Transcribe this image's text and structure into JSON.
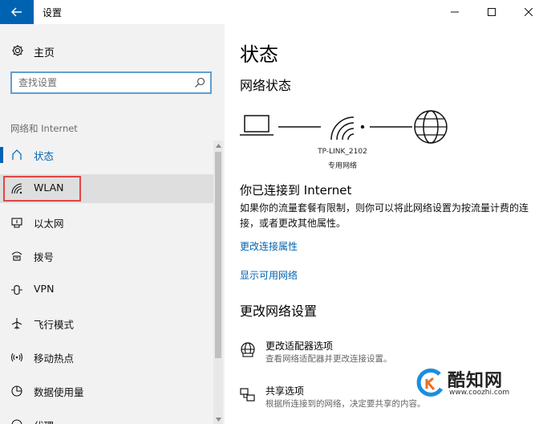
{
  "window": {
    "title": "设置",
    "controls": {
      "minimize": "—",
      "maximize": "☐",
      "close": "✕"
    }
  },
  "sidebar": {
    "home_label": "主页",
    "search": {
      "placeholder": "查找设置",
      "value": ""
    },
    "section_label": "网络和 Internet",
    "items": [
      {
        "label": "状态",
        "icon": "home-status-icon",
        "active": true
      },
      {
        "label": "WLAN",
        "icon": "wifi-icon",
        "highlighted": true
      },
      {
        "label": "以太网",
        "icon": "ethernet-icon"
      },
      {
        "label": "拨号",
        "icon": "dialup-icon"
      },
      {
        "label": "VPN",
        "icon": "vpn-icon"
      },
      {
        "label": "飞行模式",
        "icon": "airplane-icon"
      },
      {
        "label": "移动热点",
        "icon": "hotspot-icon"
      },
      {
        "label": "数据使用量",
        "icon": "data-usage-icon"
      },
      {
        "label": "代理",
        "icon": "proxy-icon"
      }
    ]
  },
  "main": {
    "page_title": "状态",
    "network_status_title": "网络状态",
    "network": {
      "name": "TP-LINK_2102",
      "type": "专用网络"
    },
    "connected_title": "你已连接到 Internet",
    "connected_desc": "如果你的流量套餐有限制，则你可以将此网络设置为按流量计费的连接，或者更改其他属性。",
    "links": {
      "change_props": "更改连接属性",
      "show_networks": "显示可用网络"
    },
    "change_settings_title": "更改网络设置",
    "options": [
      {
        "title": "更改适配器选项",
        "desc": "查看网络适配器并更改连接设置。",
        "icon": "adapter-icon"
      },
      {
        "title": "共享选项",
        "desc": "根据所连接到的网络，决定要共享的内容。",
        "icon": "sharing-icon"
      }
    ]
  },
  "watermark": {
    "text": "酷知网",
    "url": "www.coozhi.com"
  },
  "colors": {
    "accent": "#0063b1",
    "sidebar_bg": "#f2f2f2",
    "highlight": "#e04646"
  }
}
